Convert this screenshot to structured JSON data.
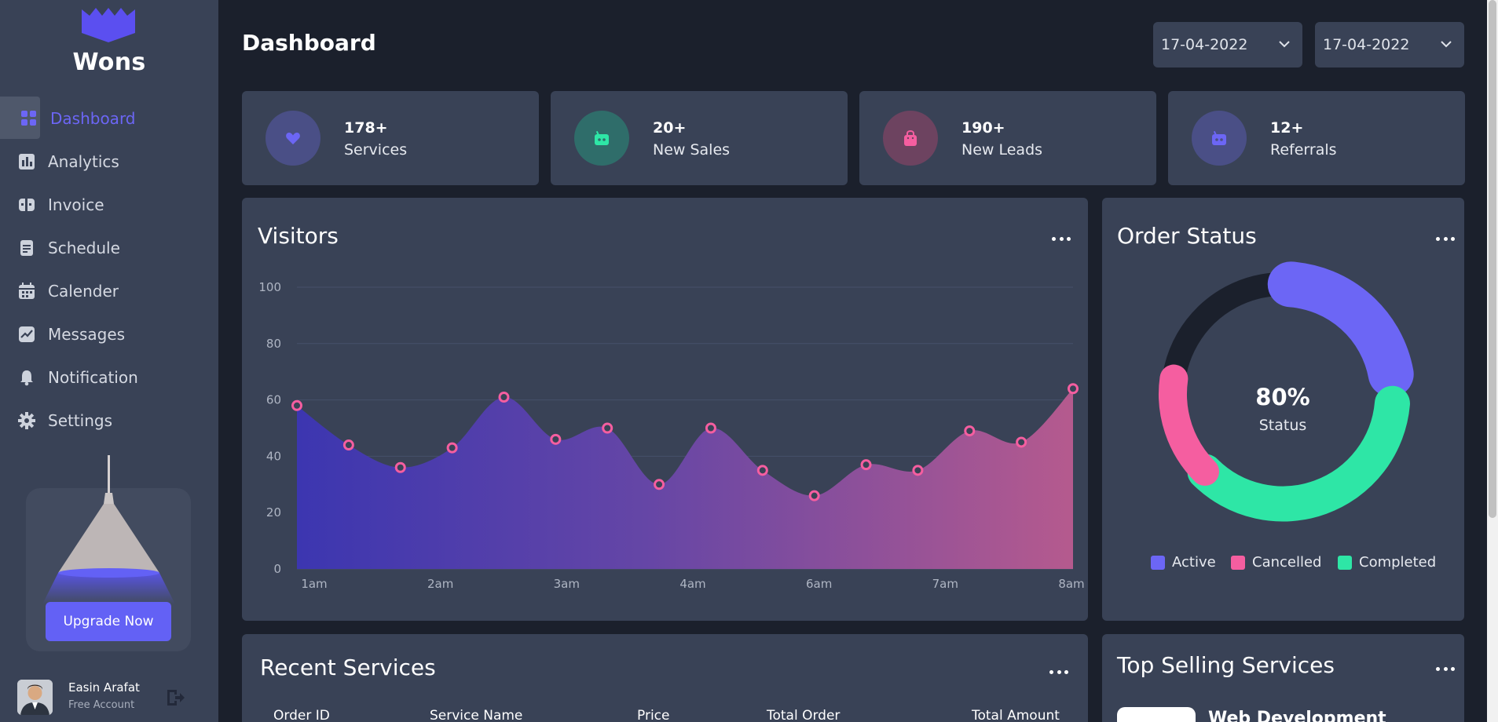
{
  "app": {
    "brand": "Wons"
  },
  "sidebar": {
    "items": [
      {
        "label": "Dashboard",
        "icon": "grid-icon",
        "active": true
      },
      {
        "label": "Analytics",
        "icon": "bar-chart-icon"
      },
      {
        "label": "Invoice",
        "icon": "invoice-icon"
      },
      {
        "label": "Schedule",
        "icon": "schedule-icon"
      },
      {
        "label": "Calender",
        "icon": "calendar-icon"
      },
      {
        "label": "Messages",
        "icon": "messages-icon"
      },
      {
        "label": "Notification",
        "icon": "bell-icon"
      },
      {
        "label": "Settings",
        "icon": "gear-icon"
      }
    ],
    "upgrade_label": "Upgrade Now",
    "user": {
      "name": "Easin Arafat",
      "role": "Free Account"
    }
  },
  "header": {
    "title": "Dashboard",
    "date_from": "17-04-2022",
    "date_to": "17-04-2022"
  },
  "stats": [
    {
      "value": "178+",
      "label": "Services",
      "icon": "heart-icon",
      "color": "#6c66f5"
    },
    {
      "value": "20+",
      "label": "New Sales",
      "icon": "robot-icon",
      "color": "#2ee6a6"
    },
    {
      "value": "190+",
      "label": "New Leads",
      "icon": "bag-icon",
      "color": "#f55ea0"
    },
    {
      "value": "12+",
      "label": "Referrals",
      "icon": "robot-icon",
      "color": "#6c66f5"
    }
  ],
  "visitors": {
    "title": "Visitors"
  },
  "order_status": {
    "title": "Order Status",
    "center_value": "80%",
    "center_label": "Status",
    "legend": [
      "Active",
      "Cancelled",
      "Completed"
    ]
  },
  "recent_services": {
    "title": "Recent Services",
    "columns": [
      "Order ID",
      "Service Name",
      "Price",
      "Total Order",
      "Total Amount"
    ]
  },
  "top_selling": {
    "title": "Top Selling Services",
    "first_item": "Web Development"
  },
  "colors": {
    "accent": "#6361f5",
    "active": "#6c66f5",
    "cancelled": "#f55ea0",
    "completed": "#2ee6a6",
    "track": "#1b202c"
  },
  "chart_data": [
    {
      "type": "area",
      "x": [
        "1am",
        "",
        "",
        "2am",
        "",
        "3am",
        "",
        "",
        "4am",
        "",
        "",
        "6am",
        "",
        "7am",
        "",
        "",
        "8am"
      ],
      "x_ticks": [
        "1am",
        "2am",
        "3am",
        "4am",
        "6am",
        "7am",
        "8am"
      ],
      "series": [
        {
          "values": [
            58,
            44,
            36,
            43,
            61,
            46,
            50,
            30,
            50,
            35,
            26,
            37,
            35,
            49,
            45,
            64
          ]
        }
      ],
      "ylim": [
        0,
        100
      ],
      "y_ticks": [
        0,
        20,
        40,
        60,
        80,
        100
      ],
      "grid": true
    },
    {
      "type": "pie",
      "categories": [
        "Active",
        "Cancelled",
        "Completed"
      ],
      "values": [
        20,
        15,
        30
      ],
      "remaining": 35,
      "center_text": "80%"
    }
  ]
}
